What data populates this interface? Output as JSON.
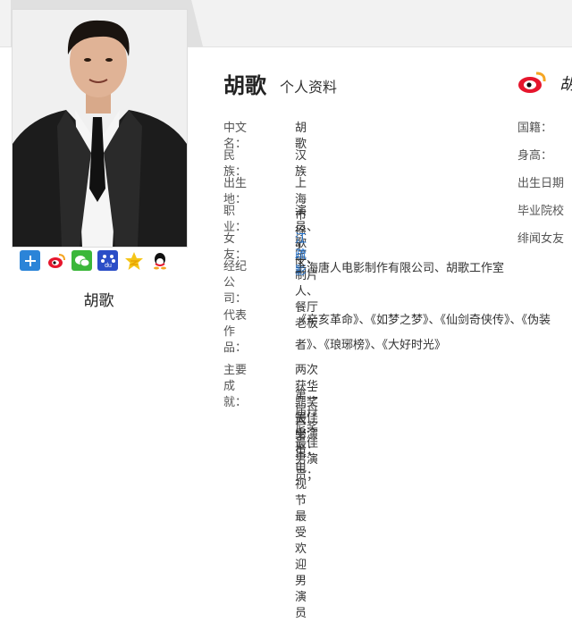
{
  "profile": {
    "name": "胡歌",
    "subtitle": "个人资料",
    "caption": "胡歌",
    "weibo_name": "胡"
  },
  "share_icons": [
    "plus-icon",
    "weibo-icon",
    "wechat-icon",
    "baidu-icon",
    "qzone-icon",
    "qq-icon"
  ],
  "left_fields": [
    {
      "label": "中文名：",
      "value": "胡歌"
    },
    {
      "label": "民族：",
      "value": "汉族"
    },
    {
      "label": "出生地：",
      "value": "上海市徐汇区"
    },
    {
      "label": "职业：",
      "value": "演员、歌手、制片人、餐厅老板"
    },
    {
      "label": "女友：",
      "value": "江疏影"
    },
    {
      "label": "经纪公司：",
      "value": "上海唐人电影制作有限公司、胡歌工作室"
    },
    {
      "label": "代表作品：",
      "value": "《辛亥革命》、《如梦之梦》、《仙剑奇侠传》、《伪装者》、《琅琊榜》、《大好时光》"
    },
    {
      "label": "主要成就：",
      "value": [
        "两次获华鼎奖最佳男演员；",
        "第二届丹尼奖最佳男演员；",
        "大学生电视节最受欢迎男演员"
      ]
    }
  ],
  "right_fields": [
    "国籍：",
    "身高：",
    "出生日期",
    "毕业院校",
    "绯闻女友"
  ],
  "colors": {
    "link": "#1a6fd0",
    "weibo_red": "#e6162d",
    "label": "#555555"
  }
}
